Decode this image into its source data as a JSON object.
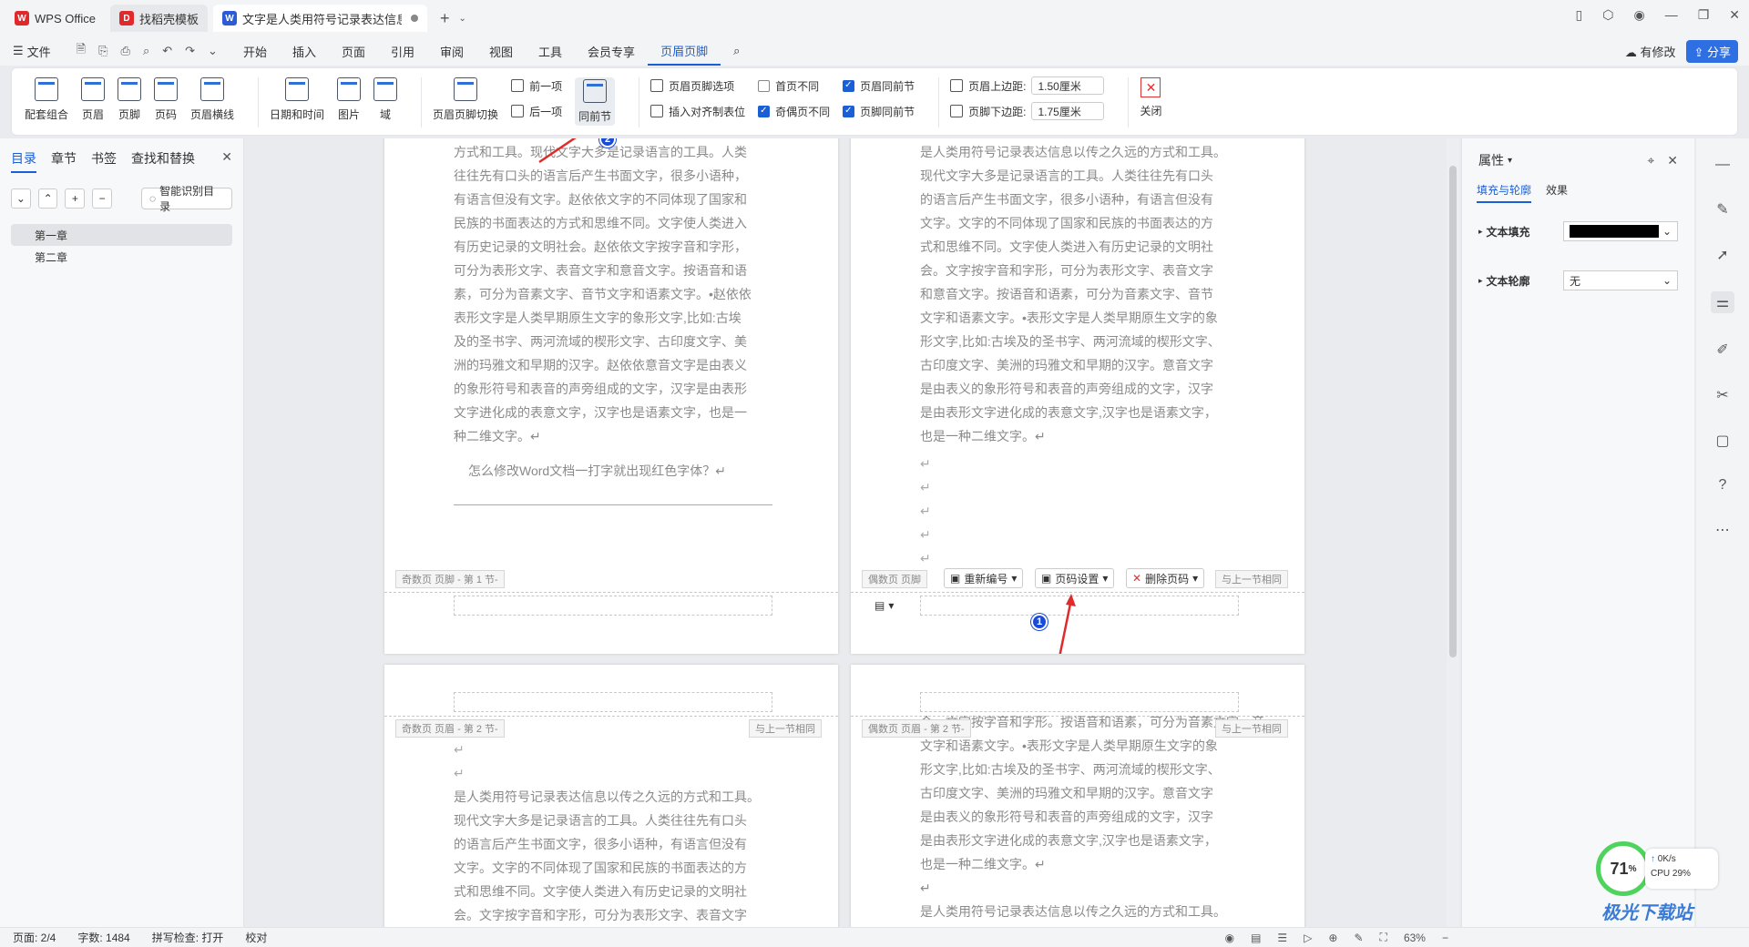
{
  "titlebar": {
    "tabs": [
      {
        "label": "WPS Office",
        "logo": "W",
        "color": "#e0292b"
      },
      {
        "label": "找稻壳模板",
        "logo": "D",
        "color": "#e0292b"
      },
      {
        "label": "文字是人类用符号记录表达信息以",
        "logo": "W",
        "color": "#2b5bd7"
      }
    ]
  },
  "menubar": {
    "file": "文件",
    "items": [
      "开始",
      "插入",
      "页面",
      "引用",
      "审阅",
      "视图",
      "工具",
      "会员专享",
      "页眉页脚"
    ],
    "right": {
      "modify": "有修改",
      "share": "分享"
    }
  },
  "ribbon": {
    "big1": [
      "配套组合",
      "页眉",
      "页脚",
      "页码",
      "页眉横线"
    ],
    "big2": [
      "日期和时间",
      "图片",
      "域"
    ],
    "switch": "页眉页脚切换",
    "prev": "前一项",
    "next": "后一项",
    "same": "同前节",
    "hf_options": "页眉页脚选项",
    "insert_tab": "插入对齐制表位",
    "first_diff": "首页不同",
    "oddeven_diff": "奇偶页不同",
    "header_same": "页眉同前节",
    "footer_same": "页脚同前节",
    "top_margin_label": "页眉上边距:",
    "top_margin": "1.50厘米",
    "bottom_margin_label": "页脚下边距:",
    "bottom_margin": "1.75厘米",
    "close": "关闭"
  },
  "leftpane": {
    "tabs": [
      "目录",
      "章节",
      "书签",
      "查找和替换"
    ],
    "ai_btn": "智能识别目录",
    "toc": [
      "第一章",
      "第二章"
    ]
  },
  "doc": {
    "p1_text": [
      "方式和工具。现代文字大多是记录语言的工具。人类",
      "往往先有口头的语言后产生书面文字，很多小语种，",
      "有语言但没有文字。赵依依文字的不同体现了国家和",
      "民族的书面表达的方式和思维不同。文字使人类进入",
      "有历史记录的文明社会。赵依依文字按字音和字形，",
      "可分为表形文字、表音文字和意音文字。按语音和语",
      "素，可分为音素文字、音节文字和语素文字。•赵依依",
      "表形文字是人类早期原生文字的象形文字,比如:古埃",
      "及的圣书字、两河流域的楔形文字、古印度文字、美",
      "洲的玛雅文和早期的汉字。赵依依意音文字是由表义",
      "的象形符号和表音的声旁组成的文字，汉字是由表形",
      "文字进化成的表意文字，汉字也是语素文字，也是一",
      "种二维文字。↵"
    ],
    "p1_question": "怎么修改Word文档一打字就出现红色字体？↵",
    "p1_footer_label": "奇数页 页脚 - 第 1 节-",
    "p2_text": [
      "是人类用符号记录表达信息以传之久远的方式和工具。",
      "现代文字大多是记录语言的工具。人类往往先有口头",
      "的语言后产生书面文字，很多小语种，有语言但没有",
      "文字。文字的不同体现了国家和民族的书面表达的方",
      "式和思维不同。文字使人类进入有历史记录的文明社",
      "会。文字按字音和字形，可分为表形文字、表音文字",
      "和意音文字。按语音和语素，可分为音素文字、音节",
      "文字和语素文字。•表形文字是人类早期原生文字的象",
      "形文字,比如:古埃及的圣书字、两河流域的楔形文字、",
      "古印度文字、美洲的玛雅文和早期的汉字。意音文字",
      "是由表义的象形符号和表音的声旁组成的文字，汉字",
      "是由表形文字进化成的表意文字,汉字也是语素文字，",
      "也是一种二维文字。↵"
    ],
    "p2_footer_label": "偶数页 页脚",
    "p2_same_label": "与上一节相同",
    "renumber": "重新编号",
    "page_setting": "页码设置",
    "delete_page": "删除页码",
    "p3_header_label": "奇数页 页眉 - 第 2 节-",
    "p3_same_label": "与上一节相同",
    "p3_text": [
      "是人类用符号记录表达信息以传之久远的方式和工具。",
      "现代文字大多是记录语言的工具。人类往往先有口头",
      "的语言后产生书面文字，很多小语种，有语言但没有",
      "文字。文字的不同体现了国家和民族的书面表达的方",
      "式和思维不同。文字使人类进入有历史记录的文明社",
      "会。文字按字音和字形，可分为表形文字、表音文字"
    ],
    "p4_header_label": "偶数页 页眉 - 第 2 节-",
    "p4_same_label": "与上一节相同",
    "p4_text": [
      "会。文字按字音和字形。按语音和语素，可分为音素文字、音",
      "文字和语素文字。•表形文字是人类早期原生文字的象",
      "形文字,比如:古埃及的圣书字、两河流域的楔形文字、",
      "古印度文字、美洲的玛雅文和早期的汉字。意音文字",
      "是由表义的象形符号和表音的声旁组成的文字，汉字",
      "是由表形文字进化成的表意文字,汉字也是语素文字，",
      "也是一种二维文字。↵",
      "↵",
      "是人类用符号记录表达信息以传之久远的方式和工具。"
    ],
    "badge1": "1",
    "badge2": "2"
  },
  "rightpane": {
    "title": "属性",
    "tabs": [
      "填充与轮廓",
      "效果"
    ],
    "fill_label": "文本填充",
    "outline_label": "文本轮廓",
    "outline_value": "无"
  },
  "statusbar": {
    "page": "页面: 2/4",
    "words": "字数: 1484",
    "spell": "拼写检查: 打开",
    "proof": "校对",
    "zoom": "63%"
  },
  "cpu": {
    "percent": "71",
    "unit": "%",
    "speed": "0K/s",
    "label": "CPU 29%"
  },
  "watermark": "极光下载站"
}
